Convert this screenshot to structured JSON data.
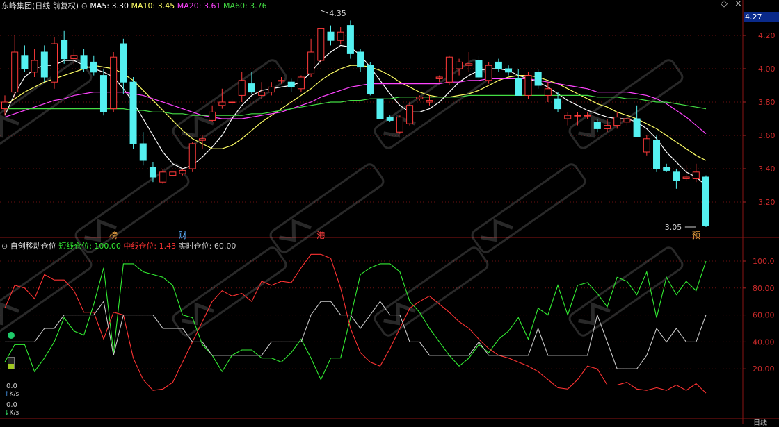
{
  "header": {
    "title": "东峰集团(日线 前复权)",
    "ma": [
      {
        "label": "MA5: 3.30",
        "color": "#ffffff"
      },
      {
        "label": "MA10: 3.45",
        "color": "#ffff66"
      },
      {
        "label": "MA20: 3.61",
        "color": "#ff44ff"
      },
      {
        "label": "MA60: 3.76",
        "color": "#44dd44"
      }
    ],
    "current_price": "4.27"
  },
  "indicator": {
    "title": "自创移动仓位",
    "lines": [
      {
        "label": "短线仓位: 100.00",
        "color": "#33ee33"
      },
      {
        "label": "中线仓位: 1.43",
        "color": "#ff3333"
      },
      {
        "label": "实时仓位: 60.00",
        "color": "#c8c8c8"
      }
    ]
  },
  "sidebar": {
    "up_value": "0.0",
    "up_unit": "K/s",
    "down_value": "0.0",
    "down_unit": "K/s"
  },
  "markers": [
    {
      "index": 11,
      "text": "榜"
    },
    {
      "index": 18,
      "text": "财"
    },
    {
      "index": 32,
      "text": "港"
    },
    {
      "index": 70,
      "text": "预"
    }
  ],
  "bottom_label": "日线",
  "chart_data": [
    {
      "type": "candlestick",
      "ylim": [
        3.0,
        4.3
      ],
      "y_ticks": [
        "4.20",
        "4.00",
        "3.80",
        "3.60",
        "3.40",
        "3.20"
      ],
      "y_tick_values": [
        4.2,
        4.0,
        3.8,
        3.6,
        3.4,
        3.2
      ],
      "annotations": [
        {
          "label": "4.35",
          "index": 32,
          "value": 4.35
        },
        {
          "label": "3.05",
          "index": 70,
          "value": 3.05
        }
      ],
      "ohlc": [
        [
          3.76,
          3.84,
          3.72,
          3.8
        ],
        [
          3.86,
          4.2,
          3.82,
          4.1
        ],
        [
          4.08,
          4.14,
          3.98,
          4.0
        ],
        [
          3.98,
          4.12,
          3.95,
          4.05
        ],
        [
          4.1,
          4.14,
          3.92,
          3.95
        ],
        [
          3.92,
          4.19,
          3.88,
          4.15
        ],
        [
          4.17,
          4.23,
          4.03,
          4.06
        ],
        [
          4.06,
          4.12,
          4.02,
          4.08
        ],
        [
          4.08,
          4.12,
          3.98,
          4.0
        ],
        [
          4.04,
          4.08,
          3.96,
          3.98
        ],
        [
          3.96,
          4.0,
          3.72,
          3.74
        ],
        [
          3.76,
          4.1,
          3.74,
          4.07
        ],
        [
          4.15,
          4.18,
          3.85,
          3.92
        ],
        [
          3.92,
          3.95,
          3.52,
          3.55
        ],
        [
          3.55,
          3.62,
          3.42,
          3.45
        ],
        [
          3.41,
          3.44,
          3.32,
          3.35
        ],
        [
          3.32,
          3.4,
          3.31,
          3.38
        ],
        [
          3.36,
          3.38,
          3.36,
          3.38
        ],
        [
          3.37,
          3.4,
          3.36,
          3.39
        ],
        [
          3.4,
          3.56,
          3.38,
          3.55
        ],
        [
          3.57,
          3.6,
          3.52,
          3.58
        ],
        [
          3.69,
          3.78,
          3.68,
          3.74
        ],
        [
          3.78,
          3.88,
          3.76,
          3.8
        ],
        [
          3.8,
          3.82,
          3.78,
          3.8
        ],
        [
          3.84,
          3.98,
          3.8,
          3.93
        ],
        [
          3.91,
          3.98,
          3.85,
          3.86
        ],
        [
          3.84,
          3.92,
          3.82,
          3.86
        ],
        [
          3.86,
          3.92,
          3.84,
          3.89
        ],
        [
          3.93,
          3.95,
          3.91,
          3.93
        ],
        [
          3.92,
          3.94,
          3.86,
          3.89
        ],
        [
          3.88,
          3.96,
          3.86,
          3.95
        ],
        [
          3.97,
          4.18,
          3.95,
          4.1
        ],
        [
          4.05,
          4.22,
          4.03,
          4.24
        ],
        [
          4.22,
          4.26,
          4.14,
          4.17
        ],
        [
          4.17,
          4.25,
          4.15,
          4.22
        ],
        [
          4.26,
          4.29,
          4.06,
          4.09
        ],
        [
          4.1,
          4.12,
          3.98,
          4.01
        ],
        [
          4.02,
          4.04,
          3.84,
          3.85
        ],
        [
          3.82,
          3.86,
          3.68,
          3.7
        ],
        [
          3.71,
          3.72,
          3.68,
          3.69
        ],
        [
          3.62,
          3.72,
          3.61,
          3.71
        ],
        [
          3.67,
          3.8,
          3.66,
          3.78
        ],
        [
          3.82,
          3.84,
          3.81,
          3.83
        ],
        [
          3.8,
          3.84,
          3.78,
          3.81
        ],
        [
          3.94,
          3.96,
          3.92,
          3.95
        ],
        [
          3.92,
          4.08,
          3.9,
          4.07
        ],
        [
          4.0,
          4.06,
          3.96,
          4.04
        ],
        [
          4.02,
          4.1,
          3.98,
          4.03
        ],
        [
          4.05,
          4.08,
          3.93,
          3.95
        ],
        [
          3.93,
          4.04,
          3.91,
          4.02
        ],
        [
          4.04,
          4.06,
          3.98,
          4.0
        ],
        [
          4.0,
          4.02,
          3.96,
          3.98
        ],
        [
          3.94,
          4.0,
          3.84,
          3.84
        ],
        [
          3.84,
          3.98,
          3.82,
          3.96
        ],
        [
          3.98,
          4.0,
          3.88,
          3.9
        ],
        [
          3.84,
          3.92,
          3.8,
          3.88
        ],
        [
          3.82,
          3.86,
          3.74,
          3.76
        ],
        [
          3.7,
          3.74,
          3.66,
          3.72
        ],
        [
          3.72,
          3.74,
          3.66,
          3.72
        ],
        [
          3.72,
          3.74,
          3.7,
          3.72
        ],
        [
          3.68,
          3.7,
          3.62,
          3.64
        ],
        [
          3.64,
          3.7,
          3.62,
          3.66
        ],
        [
          3.66,
          3.74,
          3.64,
          3.71
        ],
        [
          3.68,
          3.72,
          3.66,
          3.7
        ],
        [
          3.7,
          3.78,
          3.61,
          3.59
        ],
        [
          3.5,
          3.6,
          3.48,
          3.58
        ],
        [
          3.57,
          3.6,
          3.38,
          3.4
        ],
        [
          3.41,
          3.43,
          3.38,
          3.39
        ],
        [
          3.38,
          3.4,
          3.28,
          3.33
        ],
        [
          3.34,
          3.42,
          3.33,
          3.35
        ],
        [
          3.34,
          3.43,
          3.32,
          3.38
        ],
        [
          3.35,
          3.36,
          3.05,
          3.06
        ]
      ],
      "series": [
        {
          "name": "MA5",
          "color": "#ffffff",
          "values": [
            3.72,
            3.85,
            3.95,
            4.0,
            4.02,
            4.02,
            4.05,
            4.05,
            4.02,
            4.0,
            3.98,
            3.95,
            3.88,
            3.8,
            3.7,
            3.6,
            3.5,
            3.43,
            3.4,
            3.42,
            3.47,
            3.53,
            3.6,
            3.7,
            3.78,
            3.84,
            3.87,
            3.88,
            3.89,
            3.9,
            3.92,
            3.98,
            4.05,
            4.1,
            4.14,
            4.13,
            4.08,
            4.01,
            3.93,
            3.85,
            3.78,
            3.74,
            3.74,
            3.76,
            3.8,
            3.86,
            3.92,
            3.96,
            3.99,
            4.0,
            4.0,
            3.99,
            3.96,
            3.94,
            3.92,
            3.89,
            3.85,
            3.81,
            3.78,
            3.75,
            3.73,
            3.71,
            3.7,
            3.7,
            3.68,
            3.64,
            3.58,
            3.5,
            3.44,
            3.38,
            3.35,
            3.3
          ]
        },
        {
          "name": "MA10",
          "color": "#ffff66",
          "values": [
            3.78,
            3.82,
            3.86,
            3.89,
            3.92,
            3.94,
            3.96,
            3.98,
            4.0,
            4.02,
            4.01,
            4.0,
            3.97,
            3.93,
            3.87,
            3.81,
            3.75,
            3.69,
            3.63,
            3.58,
            3.55,
            3.52,
            3.52,
            3.54,
            3.58,
            3.63,
            3.68,
            3.72,
            3.76,
            3.8,
            3.84,
            3.88,
            3.93,
            3.97,
            4.0,
            4.02,
            4.02,
            4.01,
            3.99,
            3.96,
            3.92,
            3.89,
            3.86,
            3.84,
            3.83,
            3.83,
            3.84,
            3.85,
            3.87,
            3.9,
            3.93,
            3.95,
            3.96,
            3.96,
            3.95,
            3.93,
            3.91,
            3.88,
            3.85,
            3.82,
            3.79,
            3.77,
            3.74,
            3.72,
            3.7,
            3.67,
            3.64,
            3.6,
            3.56,
            3.52,
            3.48,
            3.45
          ]
        },
        {
          "name": "MA20",
          "color": "#ff44ff",
          "values": [
            3.71,
            3.73,
            3.75,
            3.77,
            3.79,
            3.81,
            3.82,
            3.84,
            3.85,
            3.86,
            3.86,
            3.86,
            3.86,
            3.85,
            3.84,
            3.82,
            3.8,
            3.78,
            3.76,
            3.74,
            3.72,
            3.71,
            3.7,
            3.7,
            3.7,
            3.71,
            3.72,
            3.73,
            3.74,
            3.76,
            3.78,
            3.8,
            3.83,
            3.85,
            3.87,
            3.89,
            3.9,
            3.91,
            3.91,
            3.91,
            3.91,
            3.91,
            3.91,
            3.91,
            3.91,
            3.92,
            3.92,
            3.93,
            3.93,
            3.94,
            3.94,
            3.94,
            3.94,
            3.94,
            3.93,
            3.92,
            3.91,
            3.9,
            3.89,
            3.88,
            3.86,
            3.86,
            3.86,
            3.86,
            3.85,
            3.84,
            3.82,
            3.79,
            3.75,
            3.71,
            3.66,
            3.61
          ]
        },
        {
          "name": "MA60",
          "color": "#44dd44",
          "values": [
            3.76,
            3.76,
            3.76,
            3.76,
            3.76,
            3.76,
            3.76,
            3.76,
            3.76,
            3.76,
            3.76,
            3.76,
            3.76,
            3.75,
            3.75,
            3.74,
            3.74,
            3.73,
            3.73,
            3.72,
            3.72,
            3.72,
            3.72,
            3.72,
            3.72,
            3.73,
            3.73,
            3.74,
            3.75,
            3.76,
            3.77,
            3.78,
            3.79,
            3.8,
            3.8,
            3.81,
            3.81,
            3.82,
            3.82,
            3.82,
            3.83,
            3.83,
            3.83,
            3.83,
            3.83,
            3.83,
            3.83,
            3.84,
            3.84,
            3.84,
            3.84,
            3.84,
            3.84,
            3.84,
            3.84,
            3.84,
            3.84,
            3.84,
            3.84,
            3.84,
            3.83,
            3.83,
            3.83,
            3.82,
            3.82,
            3.81,
            3.8,
            3.8,
            3.79,
            3.78,
            3.77,
            3.76
          ]
        }
      ]
    },
    {
      "type": "line",
      "ylim": [
        0,
        110
      ],
      "y_ticks": [
        "100.0",
        "80.00",
        "60.00",
        "40.00",
        "20.00"
      ],
      "y_tick_values": [
        100,
        80,
        60,
        40,
        20
      ],
      "series": [
        {
          "name": "短线仓位",
          "color": "#33ee33",
          "values": [
            25,
            38,
            38,
            18,
            28,
            40,
            58,
            48,
            45,
            68,
            95,
            32,
            98,
            98,
            92,
            90,
            88,
            82,
            60,
            58,
            38,
            30,
            18,
            30,
            34,
            34,
            28,
            28,
            25,
            32,
            42,
            28,
            12,
            28,
            28,
            58,
            90,
            95,
            98,
            98,
            92,
            70,
            62,
            50,
            40,
            30,
            22,
            28,
            38,
            32,
            42,
            48,
            58,
            42,
            65,
            60,
            82,
            60,
            82,
            84,
            76,
            66,
            88,
            85,
            75,
            92,
            58,
            88,
            75,
            85,
            78,
            100
          ]
        },
        {
          "name": "中线仓位",
          "color": "#ff3333",
          "values": [
            65,
            82,
            80,
            72,
            90,
            86,
            86,
            78,
            62,
            62,
            42,
            62,
            60,
            28,
            12,
            4,
            5,
            10,
            25,
            40,
            55,
            70,
            78,
            74,
            76,
            70,
            85,
            82,
            85,
            84,
            95,
            105,
            105,
            102,
            80,
            50,
            32,
            25,
            22,
            35,
            50,
            65,
            70,
            74,
            68,
            62,
            55,
            50,
            42,
            35,
            30,
            28,
            25,
            22,
            18,
            12,
            6,
            5,
            12,
            22,
            20,
            8,
            8,
            10,
            5,
            4,
            6,
            4,
            8,
            4,
            9,
            2
          ]
        },
        {
          "name": "实时仓位",
          "color": "#c8c8c8",
          "values": [
            40,
            40,
            40,
            40,
            50,
            50,
            60,
            60,
            60,
            60,
            70,
            30,
            60,
            60,
            60,
            60,
            50,
            50,
            50,
            40,
            40,
            30,
            30,
            30,
            30,
            30,
            30,
            40,
            40,
            40,
            40,
            60,
            70,
            70,
            60,
            60,
            50,
            60,
            70,
            60,
            60,
            40,
            40,
            30,
            30,
            30,
            30,
            30,
            40,
            30,
            30,
            30,
            30,
            30,
            50,
            30,
            30,
            30,
            30,
            30,
            60,
            40,
            20,
            20,
            20,
            30,
            50,
            40,
            50,
            40,
            40,
            60
          ]
        }
      ]
    }
  ]
}
